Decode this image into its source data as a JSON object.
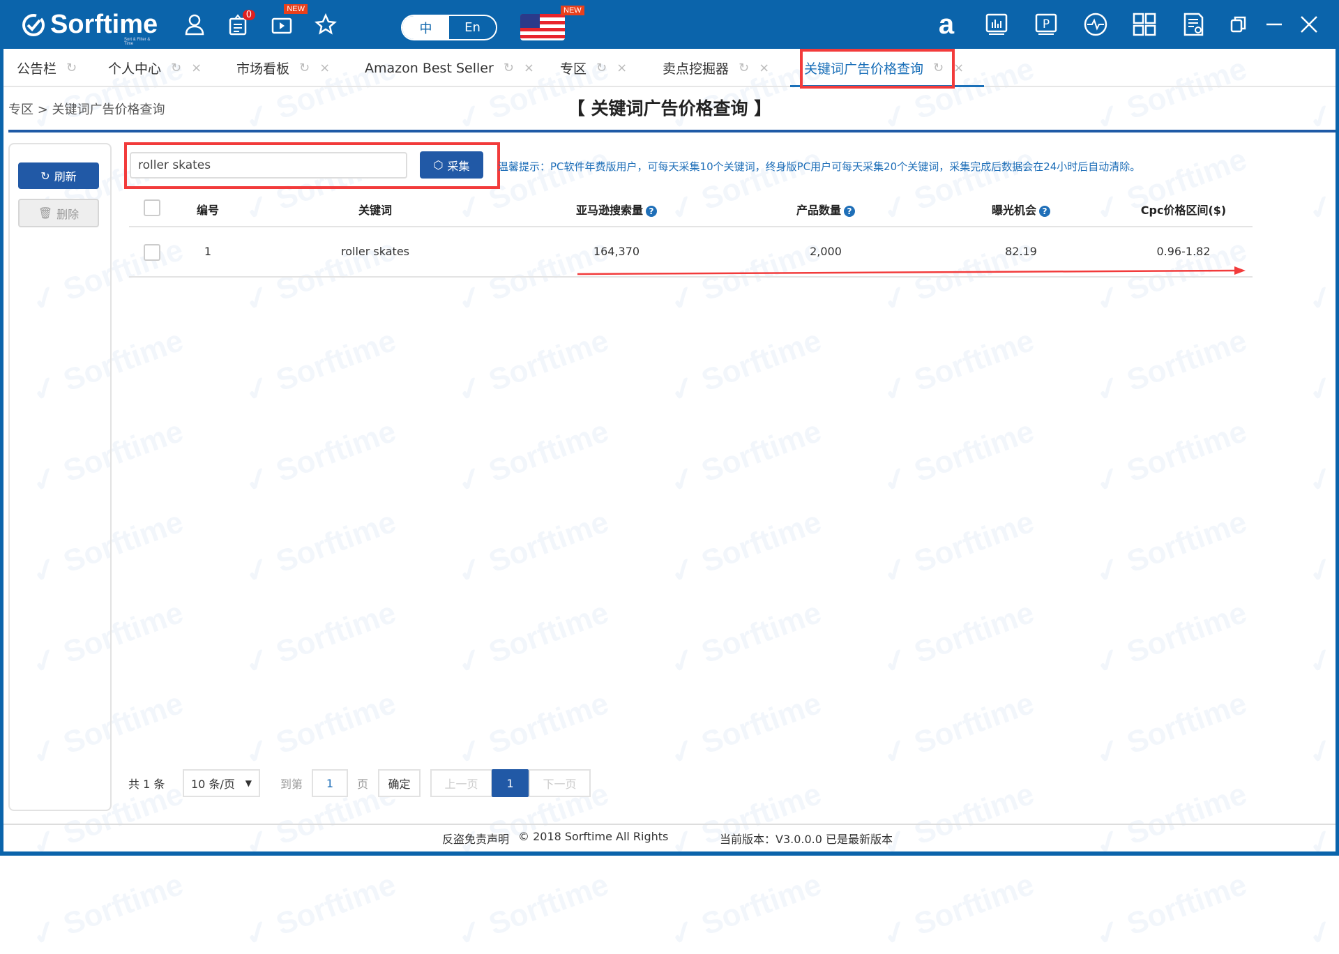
{
  "app": {
    "logo_text": "Sorftime",
    "logo_tagline": "Sort & Filter & Time",
    "watermark": "Sorftime"
  },
  "header": {
    "notice_count": "0",
    "new_badge": "NEW",
    "lang": {
      "zh": "中",
      "en": "En",
      "selected": "中"
    },
    "icons": [
      "user-icon",
      "clipboard-icon",
      "video-icon",
      "star-icon",
      "flag-us-icon",
      "amazon-icon",
      "chart-icon",
      "p-icon",
      "pulse-icon",
      "grid-icon",
      "doc-search-icon",
      "restore-icon",
      "minimize-icon",
      "close-icon"
    ]
  },
  "tabs": [
    {
      "label": "公告栏",
      "closable": false
    },
    {
      "label": "个人中心",
      "closable": true
    },
    {
      "label": "市场看板",
      "closable": true
    },
    {
      "label": "Amazon Best Seller",
      "closable": true
    },
    {
      "label": "专区",
      "closable": true
    },
    {
      "label": "卖点挖掘器",
      "closable": true
    },
    {
      "label": "关键词广告价格查询",
      "closable": true,
      "active": true
    }
  ],
  "breadcrumb": "专区 > 关键词广告价格查询",
  "page_title": "【 关键词广告价格查询 】",
  "sidebar": {
    "refresh": "刷新",
    "delete": "删除"
  },
  "search": {
    "value": "roller skates",
    "collect_button": "采集"
  },
  "tip": "温馨提示：PC软件年费版用户，可每天采集10个关键词，终身版PC用户可每天采集20个关键词，采集完成后数据会在24小时后自动清除。",
  "table": {
    "headers": [
      "编号",
      "关键词",
      "亚马逊搜索量",
      "产品数量",
      "曝光机会",
      "Cpc价格区间($)"
    ],
    "help_icon": "?",
    "rows": [
      {
        "no": "1",
        "keyword": "roller skates",
        "search_volume": "164,370",
        "product_count": "2,000",
        "exposure": "82.19",
        "cpc_range": "0.96-1.82"
      }
    ]
  },
  "pagination": {
    "total": "共 1 条",
    "page_size": "10 条/页",
    "goto_label": "到第",
    "goto_value": "1",
    "page_unit": "页",
    "confirm": "确定",
    "prev": "上一页",
    "current": "1",
    "next": "下一页"
  },
  "footer": {
    "disclaimer": "反盗免责声明",
    "copyright": "© 2018 Sorftime All Rights",
    "version": "当前版本：V3.0.0.0  已是最新版本"
  },
  "colors": {
    "brand": "#0b64ab",
    "primary_button": "#2159a6",
    "highlight": "#f23b3b",
    "tip_text": "#1f6fb8"
  }
}
